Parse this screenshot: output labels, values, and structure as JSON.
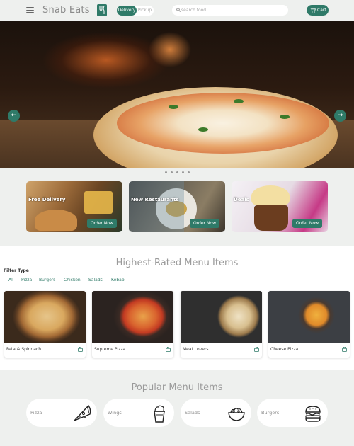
{
  "header": {
    "brand": "Snab Eats",
    "toggle": {
      "delivery": "Delivery",
      "pickup": "Pickup",
      "selected": "Delivery"
    },
    "search": {
      "placeholder": "search food",
      "value": ""
    },
    "cart_label": "Cart",
    "icons": [
      "menu-icon",
      "fork-knife-icon",
      "search-icon",
      "cart-icon"
    ]
  },
  "hero": {
    "slides": 5,
    "active_slide": 1,
    "arrow_left": "←",
    "arrow_right": "→"
  },
  "promos": [
    {
      "label": "Free Delivery",
      "button": "Order Now"
    },
    {
      "label": "New Restaurants",
      "button": "Order Now"
    },
    {
      "label": "Deals",
      "button": "Order Now"
    }
  ],
  "highest_rated": {
    "title": "Highest-Rated Menu Items",
    "filter_title": "Filter Type",
    "filters": [
      "All",
      "Pizza",
      "Burgers",
      "Chicken",
      "Salads",
      "Kebab"
    ],
    "items": [
      {
        "name": "Feta & Spinnach"
      },
      {
        "name": "Supreme Pizza"
      },
      {
        "name": "Meat Lovers"
      },
      {
        "name": "Cheese Pizza"
      }
    ]
  },
  "popular": {
    "title": "Popular Menu Items",
    "items": [
      {
        "label": "Pizza",
        "icon": "pizza-icon"
      },
      {
        "label": "Wings",
        "icon": "wings-bucket-icon"
      },
      {
        "label": "Salads",
        "icon": "salad-bowl-icon"
      },
      {
        "label": "Burgers",
        "icon": "burger-icon"
      }
    ]
  },
  "colors": {
    "accent": "#2f7a68",
    "background": "#eef0ee",
    "muted_text": "#9a9a9a"
  }
}
